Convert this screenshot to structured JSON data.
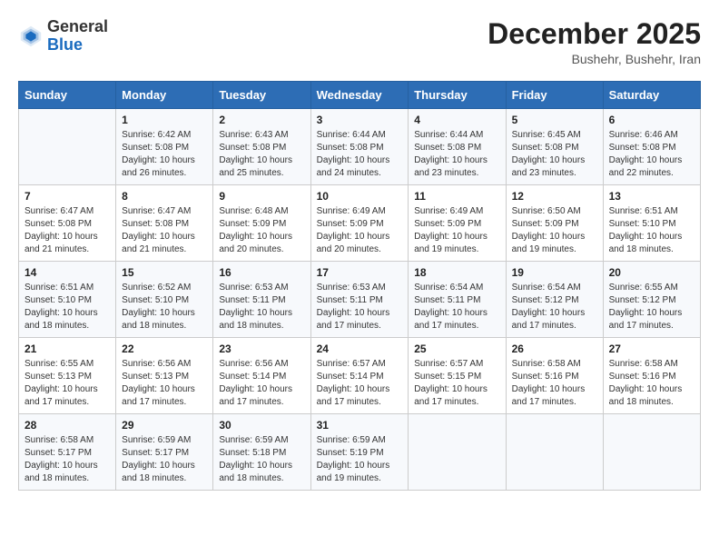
{
  "header": {
    "logo_line1": "General",
    "logo_line2": "Blue",
    "month": "December 2025",
    "location": "Bushehr, Bushehr, Iran"
  },
  "days_of_week": [
    "Sunday",
    "Monday",
    "Tuesday",
    "Wednesday",
    "Thursday",
    "Friday",
    "Saturday"
  ],
  "weeks": [
    [
      {
        "day": "",
        "info": ""
      },
      {
        "day": "1",
        "info": "Sunrise: 6:42 AM\nSunset: 5:08 PM\nDaylight: 10 hours\nand 26 minutes."
      },
      {
        "day": "2",
        "info": "Sunrise: 6:43 AM\nSunset: 5:08 PM\nDaylight: 10 hours\nand 25 minutes."
      },
      {
        "day": "3",
        "info": "Sunrise: 6:44 AM\nSunset: 5:08 PM\nDaylight: 10 hours\nand 24 minutes."
      },
      {
        "day": "4",
        "info": "Sunrise: 6:44 AM\nSunset: 5:08 PM\nDaylight: 10 hours\nand 23 minutes."
      },
      {
        "day": "5",
        "info": "Sunrise: 6:45 AM\nSunset: 5:08 PM\nDaylight: 10 hours\nand 23 minutes."
      },
      {
        "day": "6",
        "info": "Sunrise: 6:46 AM\nSunset: 5:08 PM\nDaylight: 10 hours\nand 22 minutes."
      }
    ],
    [
      {
        "day": "7",
        "info": "Sunrise: 6:47 AM\nSunset: 5:08 PM\nDaylight: 10 hours\nand 21 minutes."
      },
      {
        "day": "8",
        "info": "Sunrise: 6:47 AM\nSunset: 5:08 PM\nDaylight: 10 hours\nand 21 minutes."
      },
      {
        "day": "9",
        "info": "Sunrise: 6:48 AM\nSunset: 5:09 PM\nDaylight: 10 hours\nand 20 minutes."
      },
      {
        "day": "10",
        "info": "Sunrise: 6:49 AM\nSunset: 5:09 PM\nDaylight: 10 hours\nand 20 minutes."
      },
      {
        "day": "11",
        "info": "Sunrise: 6:49 AM\nSunset: 5:09 PM\nDaylight: 10 hours\nand 19 minutes."
      },
      {
        "day": "12",
        "info": "Sunrise: 6:50 AM\nSunset: 5:09 PM\nDaylight: 10 hours\nand 19 minutes."
      },
      {
        "day": "13",
        "info": "Sunrise: 6:51 AM\nSunset: 5:10 PM\nDaylight: 10 hours\nand 18 minutes."
      }
    ],
    [
      {
        "day": "14",
        "info": "Sunrise: 6:51 AM\nSunset: 5:10 PM\nDaylight: 10 hours\nand 18 minutes."
      },
      {
        "day": "15",
        "info": "Sunrise: 6:52 AM\nSunset: 5:10 PM\nDaylight: 10 hours\nand 18 minutes."
      },
      {
        "day": "16",
        "info": "Sunrise: 6:53 AM\nSunset: 5:11 PM\nDaylight: 10 hours\nand 18 minutes."
      },
      {
        "day": "17",
        "info": "Sunrise: 6:53 AM\nSunset: 5:11 PM\nDaylight: 10 hours\nand 17 minutes."
      },
      {
        "day": "18",
        "info": "Sunrise: 6:54 AM\nSunset: 5:11 PM\nDaylight: 10 hours\nand 17 minutes."
      },
      {
        "day": "19",
        "info": "Sunrise: 6:54 AM\nSunset: 5:12 PM\nDaylight: 10 hours\nand 17 minutes."
      },
      {
        "day": "20",
        "info": "Sunrise: 6:55 AM\nSunset: 5:12 PM\nDaylight: 10 hours\nand 17 minutes."
      }
    ],
    [
      {
        "day": "21",
        "info": "Sunrise: 6:55 AM\nSunset: 5:13 PM\nDaylight: 10 hours\nand 17 minutes."
      },
      {
        "day": "22",
        "info": "Sunrise: 6:56 AM\nSunset: 5:13 PM\nDaylight: 10 hours\nand 17 minutes."
      },
      {
        "day": "23",
        "info": "Sunrise: 6:56 AM\nSunset: 5:14 PM\nDaylight: 10 hours\nand 17 minutes."
      },
      {
        "day": "24",
        "info": "Sunrise: 6:57 AM\nSunset: 5:14 PM\nDaylight: 10 hours\nand 17 minutes."
      },
      {
        "day": "25",
        "info": "Sunrise: 6:57 AM\nSunset: 5:15 PM\nDaylight: 10 hours\nand 17 minutes."
      },
      {
        "day": "26",
        "info": "Sunrise: 6:58 AM\nSunset: 5:16 PM\nDaylight: 10 hours\nand 17 minutes."
      },
      {
        "day": "27",
        "info": "Sunrise: 6:58 AM\nSunset: 5:16 PM\nDaylight: 10 hours\nand 18 minutes."
      }
    ],
    [
      {
        "day": "28",
        "info": "Sunrise: 6:58 AM\nSunset: 5:17 PM\nDaylight: 10 hours\nand 18 minutes."
      },
      {
        "day": "29",
        "info": "Sunrise: 6:59 AM\nSunset: 5:17 PM\nDaylight: 10 hours\nand 18 minutes."
      },
      {
        "day": "30",
        "info": "Sunrise: 6:59 AM\nSunset: 5:18 PM\nDaylight: 10 hours\nand 18 minutes."
      },
      {
        "day": "31",
        "info": "Sunrise: 6:59 AM\nSunset: 5:19 PM\nDaylight: 10 hours\nand 19 minutes."
      },
      {
        "day": "",
        "info": ""
      },
      {
        "day": "",
        "info": ""
      },
      {
        "day": "",
        "info": ""
      }
    ]
  ]
}
